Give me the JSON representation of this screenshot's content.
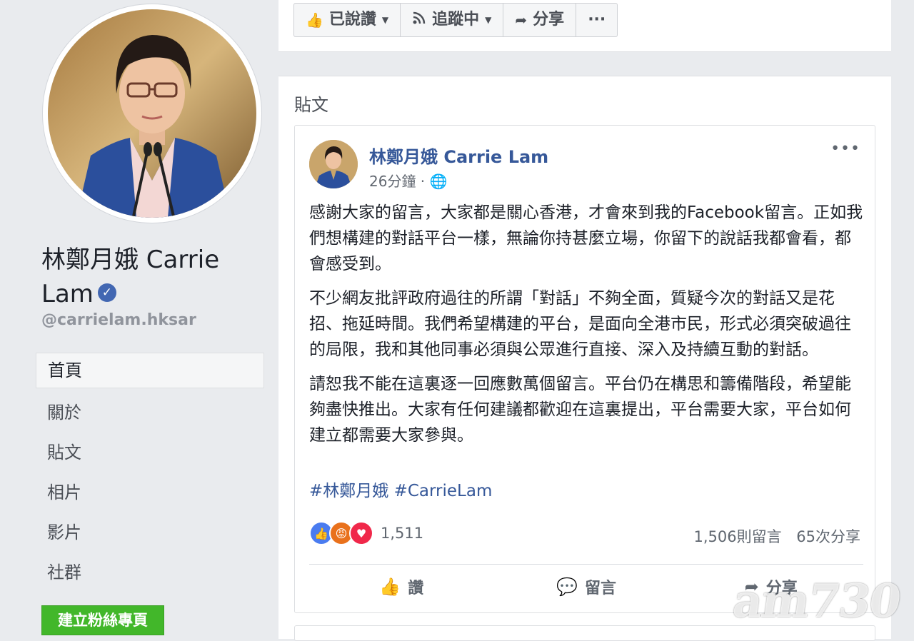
{
  "profile": {
    "name_line1": "林鄭月娥 Carrie",
    "name_line2": "Lam",
    "handle": "@carrielam.hksar",
    "verified_icon": "check-icon"
  },
  "nav": {
    "items": [
      {
        "label": "首頁",
        "active": true
      },
      {
        "label": "關於"
      },
      {
        "label": "貼文"
      },
      {
        "label": "相片"
      },
      {
        "label": "影片"
      },
      {
        "label": "社群"
      }
    ],
    "create_page": "建立粉絲專頁"
  },
  "actions_bar": {
    "liked": "已說讚",
    "following": "追蹤中",
    "share": "分享",
    "more": "···"
  },
  "posts_section": {
    "title": "貼文"
  },
  "post": {
    "author": "林鄭月娥 Carrie Lam",
    "time": "26分鐘 · ",
    "privacy_icon": "globe-icon",
    "more": "•••",
    "paragraphs": [
      "感謝大家的留言，大家都是關心香港，才會來到我的Facebook留言。正如我們想構建的對話平台一樣，無論你持甚麼立場，你留下的說話我都會看，都會感受到。",
      "不少網友批評政府過往的所謂「對話」不夠全面，質疑今次的對話又是花招、拖延時間。我們希望構建的平台，是面向全港市民，形式必須突破過往的局限，我和其他同事必須與公眾進行直接、深入及持續互動的對話。",
      "請恕我不能在這裏逐一回應數萬個留言。平台仍在構思和籌備階段，希望能夠盡快推出。大家有任何建議都歡迎在這裏提出，平台需要大家，平台如何建立都需要大家參與。"
    ],
    "hashtags": "#林鄭月娥 #CarrieLam",
    "reactions_count": "1,511",
    "comments": "1,506則留言",
    "shares": "65次分享",
    "like_action": "讚",
    "comment_action": "留言",
    "share_action": "分享"
  },
  "watermark": "am730"
}
